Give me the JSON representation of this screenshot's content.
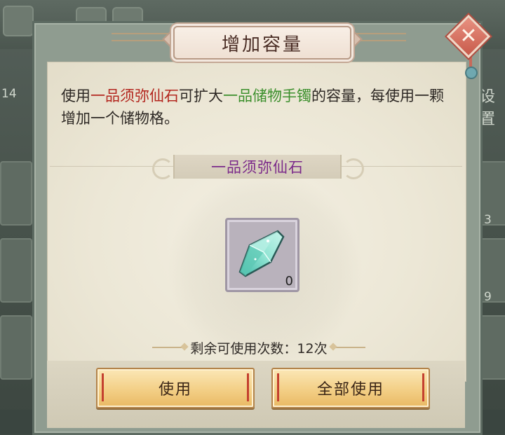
{
  "background": {
    "left_number": "14",
    "right_label": "设置",
    "right_numbers": [
      "3",
      "9"
    ]
  },
  "dialog": {
    "title": "增加容量",
    "close_symbol": "✕",
    "description": {
      "part1": "使用",
      "item_name": "一品须弥仙石",
      "part2": "可扩大",
      "target_name": "一品储物手镯",
      "part3": "的容量，每使用一颗增加一个储物格。"
    },
    "item": {
      "name": "一品须弥仙石",
      "count": "0",
      "icon": "crystal-gem-icon"
    },
    "remaining": "剩余可使用次数：12次",
    "buttons": {
      "use": "使用",
      "use_all": "全部使用"
    },
    "colors": {
      "item_name_highlight": "#b3261e",
      "target_highlight": "#3b8f2c",
      "item_name_bar": "#7b2a8a",
      "button_fill": "#f3cf86"
    }
  }
}
